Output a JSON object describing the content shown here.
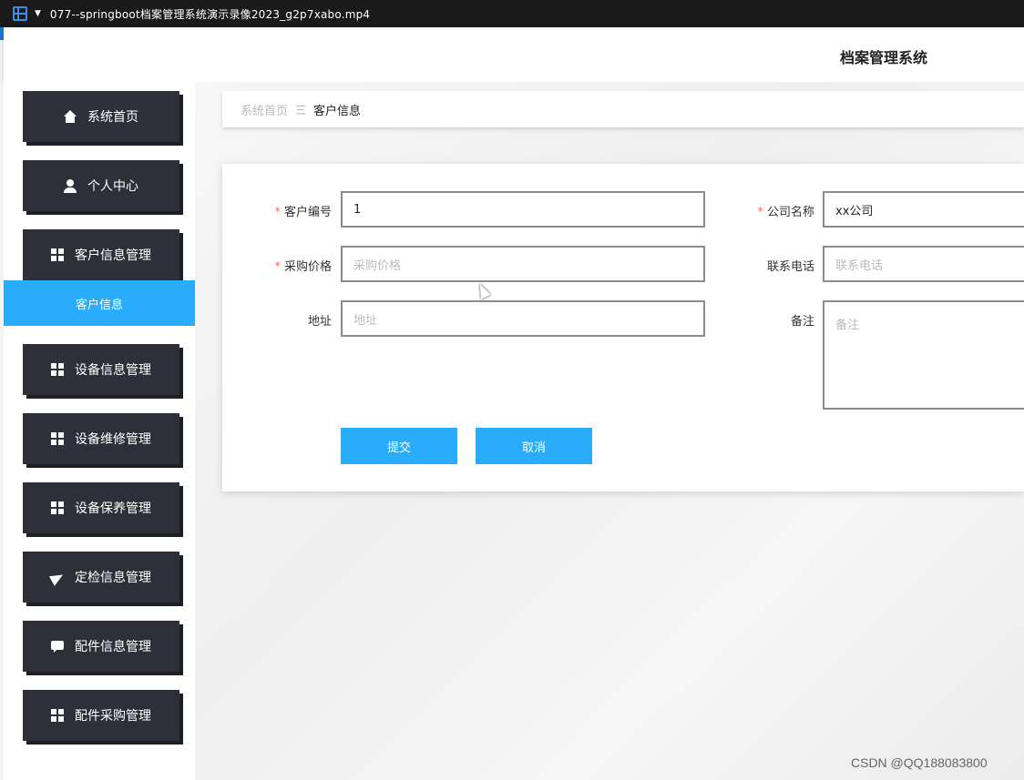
{
  "window": {
    "title": "077--springboot档案管理系统演示录像2023_g2p7xabo.mp4"
  },
  "header": {
    "system_title": "档案管理系统"
  },
  "sidebar": {
    "items": [
      {
        "label": "系统首页",
        "icon": "home-icon"
      },
      {
        "label": "个人中心",
        "icon": "user-icon"
      },
      {
        "label": "客户信息管理",
        "icon": "grid-icon"
      },
      {
        "label": "设备信息管理",
        "icon": "grid-icon"
      },
      {
        "label": "设备维修管理",
        "icon": "grid-icon"
      },
      {
        "label": "设备保养管理",
        "icon": "grid-icon"
      },
      {
        "label": "定检信息管理",
        "icon": "send-icon"
      },
      {
        "label": "配件信息管理",
        "icon": "chat-icon"
      },
      {
        "label": "配件采购管理",
        "icon": "grid-icon"
      }
    ],
    "active_submenu": "客户信息"
  },
  "breadcrumb": {
    "home": "系统首页",
    "separator": "三",
    "current": "客户信息"
  },
  "form": {
    "customer_no": {
      "label": "客户编号",
      "value": "1",
      "required": true
    },
    "company_name": {
      "label": "公司名称",
      "value": "xx公司",
      "required": true
    },
    "purchase_price": {
      "label": "采购价格",
      "placeholder": "采购价格",
      "required": true
    },
    "phone": {
      "label": "联系电话",
      "placeholder": "联系电话",
      "required": false
    },
    "address": {
      "label": "地址",
      "placeholder": "地址",
      "required": false
    },
    "remark": {
      "label": "备注",
      "placeholder": "备注",
      "required": false
    },
    "required_mark": "*",
    "submit_label": "提交",
    "cancel_label": "取消"
  },
  "watermark": "CSDN @QQ188083800",
  "colors": {
    "accent": "#29adfb",
    "sidebar_button": "#2d3039",
    "required": "#f56c6c"
  }
}
